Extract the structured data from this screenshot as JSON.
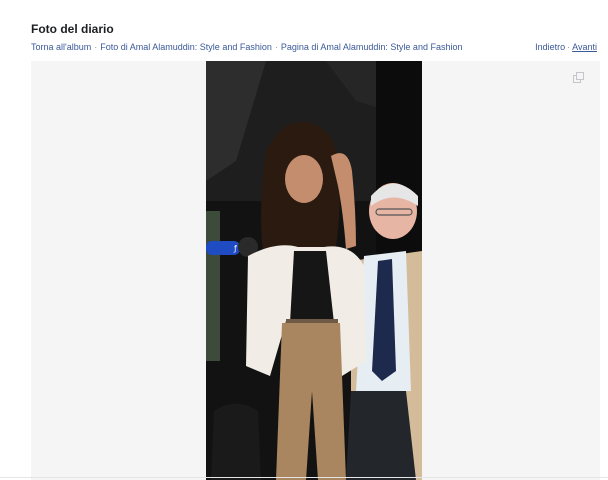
{
  "header": {
    "title": "Foto del diario"
  },
  "breadcrumbs": {
    "back_to_album": "Torna all'album",
    "separator": "·",
    "photos_of": "Foto di Amal Alamuddin: Style and Fashion",
    "page_of": "Pagina di Amal Alamuddin: Style and Fashion"
  },
  "pager": {
    "previous": "Indietro",
    "separator": "·",
    "next": "Avanti"
  },
  "viewer": {
    "background_color": "#f5f5f5",
    "expand_icon": "expand-icon"
  },
  "colors": {
    "link": "#3b5998",
    "title": "#1c1e21",
    "muted": "#90949c"
  }
}
